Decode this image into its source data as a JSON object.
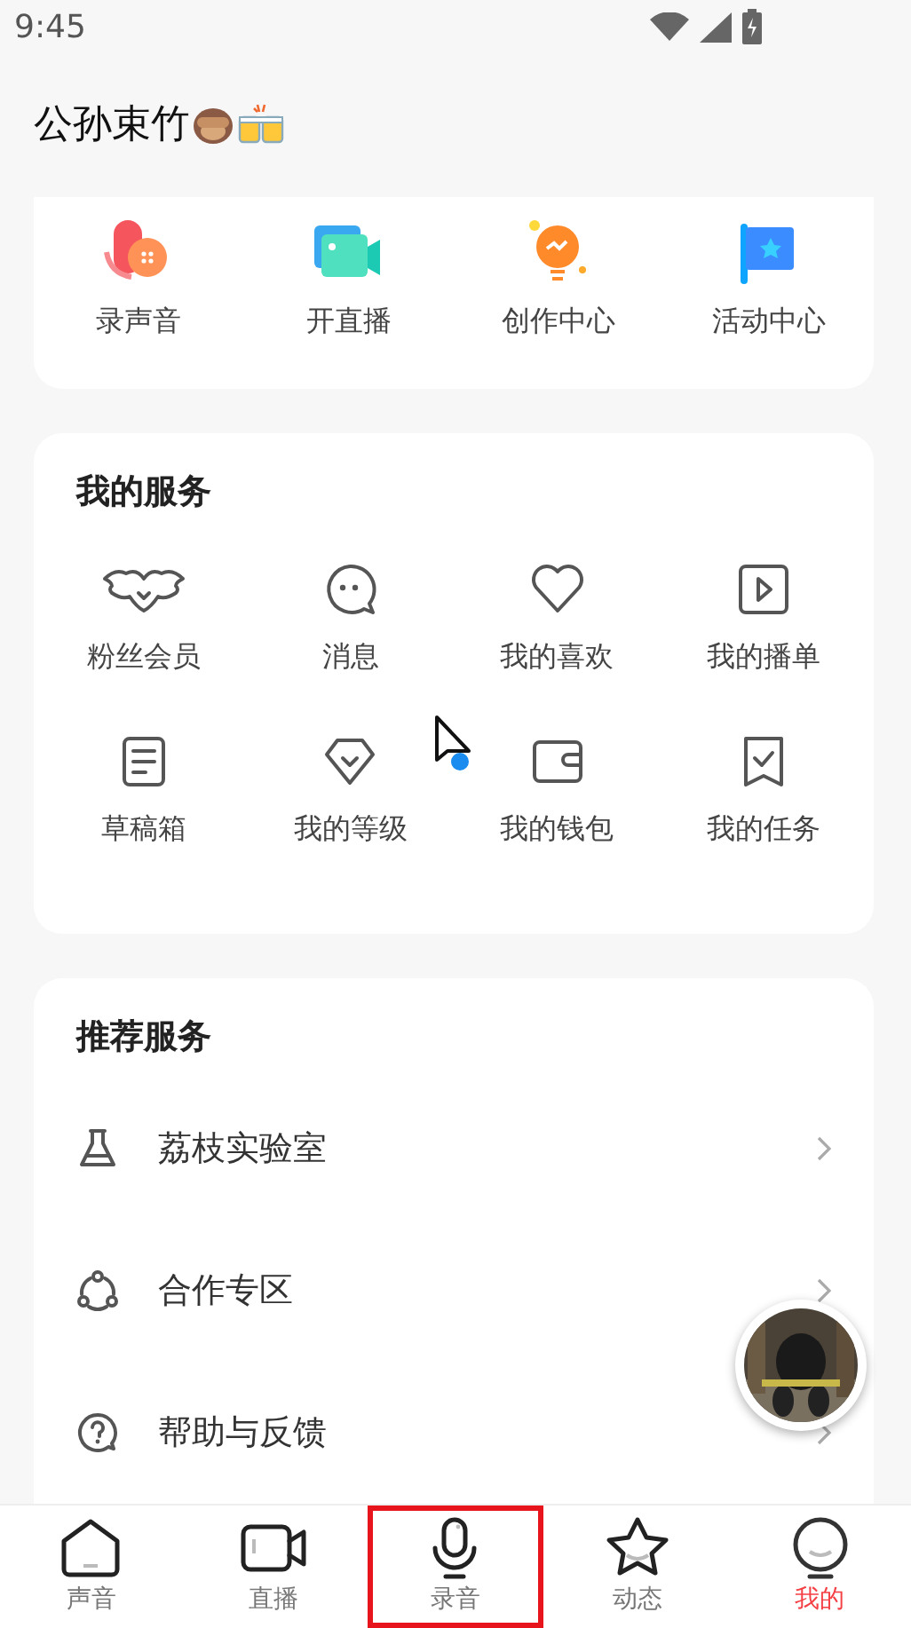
{
  "status_bar": {
    "time": "9:45"
  },
  "profile": {
    "name": "公孙束竹"
  },
  "quick_actions": [
    {
      "label": "录声音",
      "kind": "record"
    },
    {
      "label": "开直播",
      "kind": "live"
    },
    {
      "label": "创作中心",
      "kind": "create"
    },
    {
      "label": "活动中心",
      "kind": "event"
    }
  ],
  "my_services": {
    "title": "我的服务",
    "items": [
      {
        "label": "粉丝会员",
        "kind": "wings"
      },
      {
        "label": "消息",
        "kind": "chat"
      },
      {
        "label": "我的喜欢",
        "kind": "heart"
      },
      {
        "label": "我的播单",
        "kind": "play"
      },
      {
        "label": "草稿箱",
        "kind": "doc"
      },
      {
        "label": "我的等级",
        "kind": "gem"
      },
      {
        "label": "我的钱包",
        "kind": "wallet"
      },
      {
        "label": "我的任务",
        "kind": "task"
      }
    ]
  },
  "recommended": {
    "title": "推荐服务",
    "items": [
      {
        "label": "荔枝实验室",
        "kind": "flask"
      },
      {
        "label": "合作专区",
        "kind": "coop"
      },
      {
        "label": "帮助与反馈",
        "kind": "help"
      }
    ]
  },
  "tab_bar": [
    {
      "label": "声音",
      "kind": "home",
      "selected": false,
      "highlighted": false
    },
    {
      "label": "直播",
      "kind": "video",
      "selected": false,
      "highlighted": false
    },
    {
      "label": "录音",
      "kind": "mic",
      "selected": false,
      "highlighted": true
    },
    {
      "label": "动态",
      "kind": "star",
      "selected": false,
      "highlighted": false
    },
    {
      "label": "我的",
      "kind": "face",
      "selected": true,
      "highlighted": false
    }
  ]
}
